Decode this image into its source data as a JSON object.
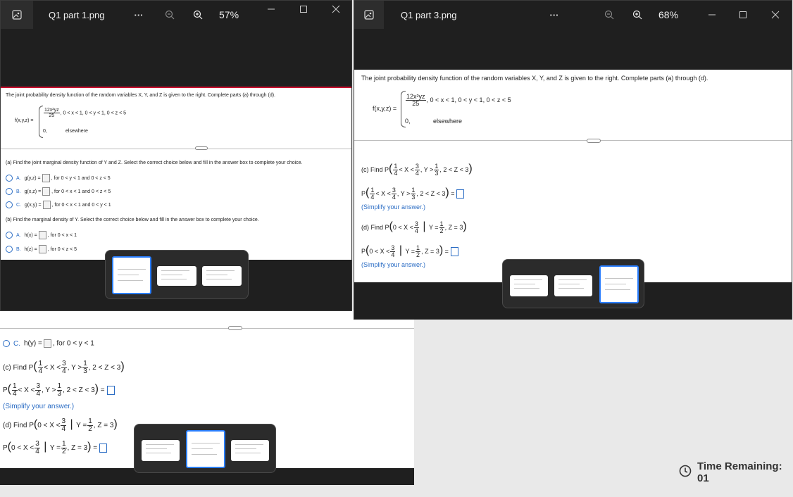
{
  "colors": {
    "accent": "#2a6cc4",
    "selection": "#2b7fff",
    "titlebar": "#1f1f1f"
  },
  "left_window": {
    "title": "Q1 part 1.png",
    "more": "···",
    "zoom": "57%",
    "intro": "The joint probability density function of the random variables X, Y, and Z is given to the right. Complete parts (a) through (d).",
    "fn_label": "f(x,y,z) =",
    "case1_expr": "12x²yz",
    "case1_den": "25",
    "case1_cond": ",   0 < x < 1, 0 < y < 1, 0 < z < 5",
    "case2_expr": "0,",
    "case2_cond": "elsewhere",
    "part_a": "(a) Find the joint marginal density function of Y and Z. Select the correct choice below and fill in the answer box to complete your choice.",
    "a_options": [
      {
        "letter": "A.",
        "lhs": "g(y,z) =",
        "rhs": ", for 0 < y < 1 and 0 < z < 5"
      },
      {
        "letter": "B.",
        "lhs": "g(x,z) =",
        "rhs": ", for 0 < x < 1 and 0 < z < 5"
      },
      {
        "letter": "C.",
        "lhs": "g(x,y) =",
        "rhs": ", for 0 < x < 1 and 0 < y < 1"
      }
    ],
    "part_b": "(b) Find the marginal density of Y. Select the correct choice below and fill in the answer box to complete your choice.",
    "b_options": [
      {
        "letter": "A.",
        "lhs": "h(x) =",
        "rhs": ", for 0 < x < 1"
      },
      {
        "letter": "B.",
        "lhs": "h(z) =",
        "rhs": ", for 0 < z < 5"
      }
    ]
  },
  "bottom_window": {
    "c_option": {
      "letter": "C.",
      "lhs": "h(y) =",
      "rhs": ", for 0 < y < 1"
    },
    "part_c": "(c) Find P",
    "part_c_expr": "< X <",
    "part_c_tail": ", 2 < Z < 3",
    "part_c_answer_lhs": "P",
    "simplify": "(Simplify your answer.)",
    "part_d": "(d) Find P",
    "part_d_expr": "0 < X <",
    "part_d_tail": ", Z = 3",
    "part_d_answer_lhs": "P",
    "eq": "=",
    "y_gt": ", Y >",
    "y_eq": "Y =",
    "f14_n": "1",
    "f14_d": "4",
    "f34_n": "3",
    "f34_d": "4",
    "f13_n": "1",
    "f13_d": "3",
    "f12_n": "1",
    "f12_d": "2"
  },
  "right_window": {
    "title": "Q1 part 3.png",
    "more": "···",
    "zoom": "68%",
    "intro": "The joint probability density function of the random variables X, Y, and Z is given to the right. Complete parts (a) through (d).",
    "fn_label": "f(x,y,z) =",
    "case1_expr": "12x²yz",
    "case1_den": "25",
    "case1_cond": ",   0 < x < 1, 0 < y < 1, 0 < z < 5",
    "case2_expr": "0,",
    "case2_cond": "elsewhere",
    "part_c": "(c) Find P",
    "part_c_answer_lhs": "P",
    "simplify": "(Simplify your answer.)",
    "part_d": "(d) Find P",
    "part_d_answer_lhs": "P"
  },
  "timer": {
    "label": "Time Remaining: 01"
  }
}
